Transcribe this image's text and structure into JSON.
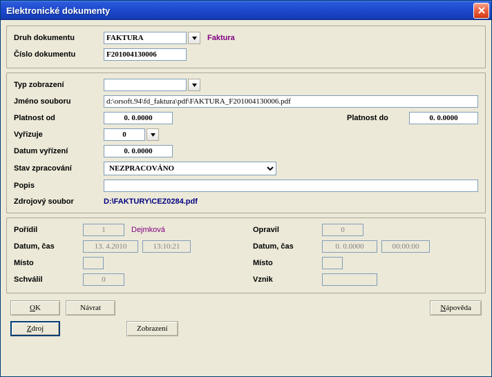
{
  "title": "Elektronické dokumenty",
  "section1": {
    "druh_label": "Druh dokumentu",
    "druh_value": "FAKTURA",
    "druh_desc": "Faktura",
    "cislo_label": "Číslo dokumentu",
    "cislo_value": "F201004130006"
  },
  "section2": {
    "typ_label": "Typ zobrazení",
    "typ_value": "",
    "jmeno_label": "Jméno souboru",
    "jmeno_value": "d:\\orsoft.94\\fd_faktura\\pdf\\FAKTURA_F201004130006.pdf",
    "plat_od_label": "Platnost od",
    "plat_od_value": "0. 0.0000",
    "plat_do_label": "Platnost do",
    "plat_do_value": "0. 0.0000",
    "vyrizuje_label": "Vyřizuje",
    "vyrizuje_value": "0",
    "datum_vyr_label": "Datum vyřízení",
    "datum_vyr_value": "0. 0.0000",
    "stav_label": "Stav zpracování",
    "stav_value": "NEZPRACOVÁNO",
    "popis_label": "Popis",
    "popis_value": "",
    "zdrojovy_label": "Zdrojový soubor",
    "zdrojovy_value": "D:\\FAKTURY\\CEZ0284.pdf"
  },
  "section3": {
    "poridil_label": "Pořídil",
    "poridil_value": "1",
    "poridil_name": "Dejmková",
    "opravil_label": "Opravil",
    "opravil_value": "0",
    "datum_label": "Datum, čas",
    "datum1_value": "13. 4.2010",
    "cas1_value": "13:10:21",
    "datum2_value": "0. 0.0000",
    "cas2_value": "00:00:00",
    "misto_label": "Místo",
    "misto1_value": "",
    "misto2_value": "",
    "schvalil_label": "Schválil",
    "schvalil_value": "0",
    "vznik_label": "Vznik",
    "vznik_value": ""
  },
  "buttons": {
    "ok": "OK",
    "navrat": "Návrat",
    "napoveda": "Nápověda",
    "zdroj": "Zdroj",
    "zobrazeni": "Zobrazení"
  }
}
